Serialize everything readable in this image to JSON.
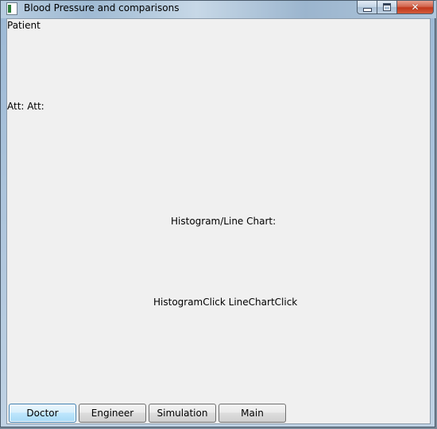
{
  "window": {
    "title": "Blood Pressure and comparisons",
    "icon": "app-window-icon",
    "caption_buttons": {
      "minimize_icon": "minimize-icon",
      "maximize_icon": "maximize-icon",
      "close_glyph": "✕"
    }
  },
  "content": {
    "patient_label": "Patient",
    "att_label": "Att: Att:",
    "chart_label": "Histogram/Line Chart:",
    "click_label": "HistogramClick LineChartClick"
  },
  "bottom_buttons": [
    {
      "label": "Doctor"
    },
    {
      "label": "Engineer"
    },
    {
      "label": "Simulation"
    },
    {
      "label": "Main"
    }
  ],
  "colors": {
    "client_background": "#f0f0f0",
    "focused_button_border": "#3c7fb1",
    "close_button": "#c1371b"
  }
}
